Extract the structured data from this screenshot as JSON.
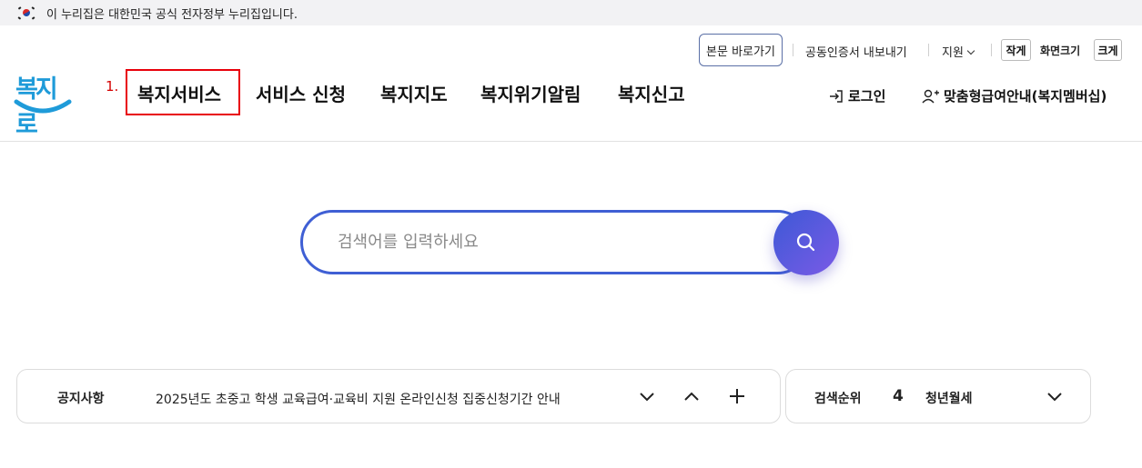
{
  "gov_banner": {
    "text": "이 누리집은 대한민국 공식 전자정부 누리집입니다."
  },
  "utility": {
    "skip_to_content": "본문 바로가기",
    "cert_export": "공동인증서 내보내기",
    "support": "지원",
    "font_smaller": "작게",
    "font_size_label": "화면크기",
    "font_larger": "크게"
  },
  "logo": {
    "text": "복지로",
    "color": "#1f9bd9"
  },
  "annotation": {
    "step": "1."
  },
  "nav": [
    {
      "label": "복지서비스"
    },
    {
      "label": "서비스 신청"
    },
    {
      "label": "복지지도"
    },
    {
      "label": "복지위기알림"
    },
    {
      "label": "복지신고"
    }
  ],
  "account": {
    "login": "로그인",
    "member_guide": "맞춤형급여안내(복지멤버십)"
  },
  "search": {
    "placeholder": "검색어를 입력하세요",
    "value": ""
  },
  "notice": {
    "title": "공지사항",
    "text": "2025년도 초중고 학생 교육급여·교육비 지원 온라인신청 집중신청기간 안내"
  },
  "ranking": {
    "title": "검색순위",
    "rank": "4",
    "term": "청년월세"
  },
  "colors": {
    "accent": "#3f5fd4",
    "highlight": "#e8000b",
    "search_gradient_start": "#3d59d6",
    "search_gradient_end": "#7a5ae6"
  }
}
